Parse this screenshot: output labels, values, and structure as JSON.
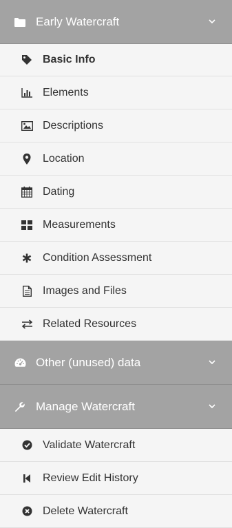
{
  "sections": [
    {
      "title": "Early Watercraft",
      "icon": "folder-icon",
      "items": [
        {
          "label": "Basic Info",
          "icon": "tag-icon",
          "active": true
        },
        {
          "label": "Elements",
          "icon": "bar-chart-icon"
        },
        {
          "label": "Descriptions",
          "icon": "image-icon"
        },
        {
          "label": "Location",
          "icon": "map-marker-icon"
        },
        {
          "label": "Dating",
          "icon": "calendar-icon"
        },
        {
          "label": "Measurements",
          "icon": "grid-icon"
        },
        {
          "label": "Condition Assessment",
          "icon": "asterisk-icon"
        },
        {
          "label": "Images and Files",
          "icon": "file-text-icon"
        },
        {
          "label": "Related Resources",
          "icon": "exchange-icon"
        }
      ]
    },
    {
      "title": "Other (unused) data",
      "icon": "dashboard-icon",
      "items": []
    },
    {
      "title": "Manage Watercraft",
      "icon": "wrench-icon",
      "items": [
        {
          "label": "Validate Watercraft",
          "icon": "check-circle-icon"
        },
        {
          "label": "Review Edit History",
          "icon": "step-backward-icon"
        },
        {
          "label": "Delete Watercraft",
          "icon": "times-circle-icon"
        }
      ]
    }
  ],
  "colors": {
    "header_bg": "#a3a3a3",
    "item_bg": "#f5f5f5",
    "text": "#333333",
    "divider": "#e0e0e0"
  }
}
